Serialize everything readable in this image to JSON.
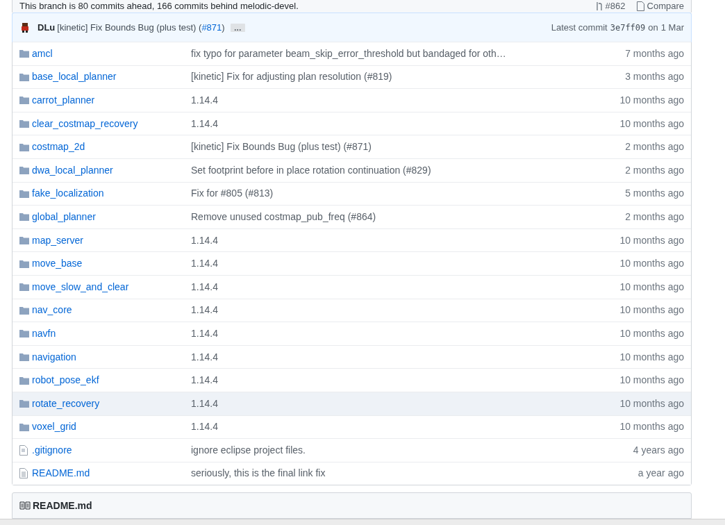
{
  "branch_status": {
    "text": "This branch is 80 commits ahead, 166 commits behind melodic-devel.",
    "pull_request": "#862",
    "compare": "Compare"
  },
  "latest_commit": {
    "author": "DLu",
    "message": "[kinetic] Fix Bounds Bug (plus test) (",
    "link": "#871",
    "message_end": ")",
    "ellipsis": "…",
    "label": "Latest commit",
    "sha": "3e7ff09",
    "date_prefix": "on",
    "date": "1 Mar"
  },
  "files": [
    {
      "kind": "folder",
      "name": "amcl",
      "message": "fix typo for parameter beam_skip_error_threshold but bandaged for oth…",
      "age": "7 months ago",
      "highlighted": false
    },
    {
      "kind": "folder",
      "name": "base_local_planner",
      "message": "[kinetic] Fix for adjusting plan resolution (#819)",
      "age": "3 months ago",
      "highlighted": false
    },
    {
      "kind": "folder",
      "name": "carrot_planner",
      "message": "1.14.4",
      "age": "10 months ago",
      "highlighted": false
    },
    {
      "kind": "folder",
      "name": "clear_costmap_recovery",
      "message": "1.14.4",
      "age": "10 months ago",
      "highlighted": false
    },
    {
      "kind": "folder",
      "name": "costmap_2d",
      "message": "[kinetic] Fix Bounds Bug (plus test) (#871)",
      "age": "2 months ago",
      "highlighted": false
    },
    {
      "kind": "folder",
      "name": "dwa_local_planner",
      "message": "Set footprint before in place rotation continuation (#829)",
      "age": "2 months ago",
      "highlighted": false
    },
    {
      "kind": "folder",
      "name": "fake_localization",
      "message": "Fix for #805 (#813)",
      "age": "5 months ago",
      "highlighted": false
    },
    {
      "kind": "folder",
      "name": "global_planner",
      "message": "Remove unused costmap_pub_freq (#864)",
      "age": "2 months ago",
      "highlighted": false
    },
    {
      "kind": "folder",
      "name": "map_server",
      "message": "1.14.4",
      "age": "10 months ago",
      "highlighted": false
    },
    {
      "kind": "folder",
      "name": "move_base",
      "message": "1.14.4",
      "age": "10 months ago",
      "highlighted": false
    },
    {
      "kind": "folder",
      "name": "move_slow_and_clear",
      "message": "1.14.4",
      "age": "10 months ago",
      "highlighted": false
    },
    {
      "kind": "folder",
      "name": "nav_core",
      "message": "1.14.4",
      "age": "10 months ago",
      "highlighted": false
    },
    {
      "kind": "folder",
      "name": "navfn",
      "message": "1.14.4",
      "age": "10 months ago",
      "highlighted": false
    },
    {
      "kind": "folder",
      "name": "navigation",
      "message": "1.14.4",
      "age": "10 months ago",
      "highlighted": false
    },
    {
      "kind": "folder",
      "name": "robot_pose_ekf",
      "message": "1.14.4",
      "age": "10 months ago",
      "highlighted": false
    },
    {
      "kind": "folder",
      "name": "rotate_recovery",
      "message": "1.14.4",
      "age": "10 months ago",
      "highlighted": true
    },
    {
      "kind": "folder",
      "name": "voxel_grid",
      "message": "1.14.4",
      "age": "10 months ago",
      "highlighted": false
    },
    {
      "kind": "file",
      "name": ".gitignore",
      "message": "ignore eclipse project files.",
      "age": "4 years ago",
      "highlighted": false
    },
    {
      "kind": "text",
      "name": "README.md",
      "message": "seriously, this is the final link fix",
      "age": "a year ago",
      "highlighted": false
    }
  ],
  "readme": {
    "title": "README.md"
  }
}
